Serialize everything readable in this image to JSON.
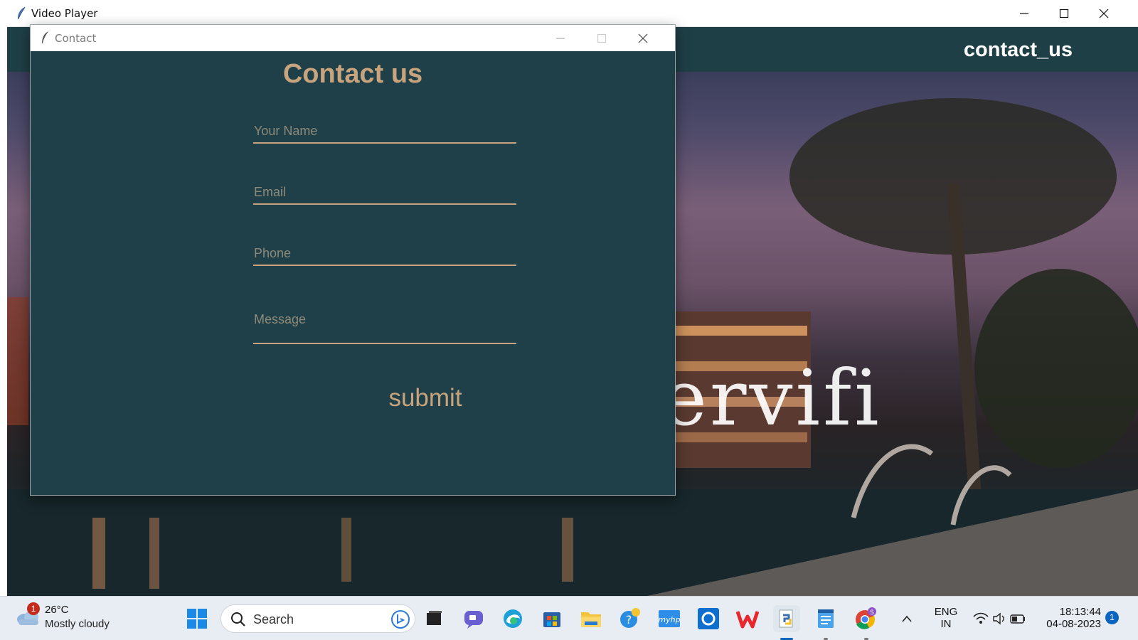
{
  "main_window": {
    "title": "Video Player",
    "nav_link": "contact_us",
    "video_text": "ervifi"
  },
  "dialog": {
    "title": "Contact",
    "heading": "Contact us",
    "fields": {
      "name_placeholder": "Your Name",
      "email_placeholder": "Email",
      "phone_placeholder": "Phone",
      "message_placeholder": "Message"
    },
    "submit_label": "submit"
  },
  "taskbar": {
    "weather": {
      "badge": "1",
      "temp": "26°C",
      "desc": "Mostly cloudy"
    },
    "search_label": "Search",
    "pinned_apps": [
      "windows-start",
      "task-view",
      "teams-chat",
      "edge",
      "microsoft-store",
      "file-explorer",
      "get-help",
      "myhp",
      "cortana",
      "wps-office",
      "python-idle",
      "notepad",
      "chrome"
    ],
    "language": {
      "line1": "ENG",
      "line2": "IN"
    },
    "clock": {
      "time": "18:13:44",
      "date": "04-08-2023"
    },
    "notification_count": "1"
  },
  "colors": {
    "teal_bg": "#1f4048",
    "accent_tan": "#c8a47e",
    "taskbar_bg": "#e8edf3"
  }
}
